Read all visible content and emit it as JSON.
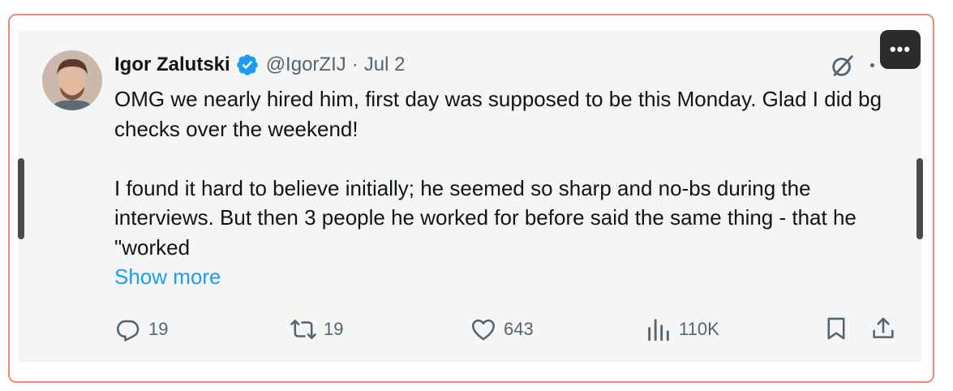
{
  "post": {
    "author_name": "Igor Zalutski",
    "handle": "@IgorZIJ",
    "separator": "·",
    "date": "Jul 2",
    "paragraph_1": "OMG we nearly hired him, first day was supposed to be this Monday. Glad I did bg checks over the weekend!",
    "paragraph_2": "I found it hard to believe initially; he seemed so sharp and no-bs during the interviews. But then 3 people he worked for before said the same thing - that he \"worked",
    "show_more": "Show more"
  },
  "actions": {
    "replies": "19",
    "reposts": "19",
    "likes": "643",
    "views": "110K"
  },
  "overlay": {
    "more_label": "•••"
  },
  "icons": [
    "verified-icon",
    "grok-icon",
    "reply-icon",
    "repost-icon",
    "like-icon",
    "views-icon",
    "bookmark-icon",
    "share-icon",
    "more-icon"
  ],
  "colors": {
    "accent": "#1d9bf0",
    "text_primary": "#0f1419",
    "text_secondary": "#536471",
    "card_bg": "#f5f5f5",
    "frame_border": "#f08a6e"
  }
}
